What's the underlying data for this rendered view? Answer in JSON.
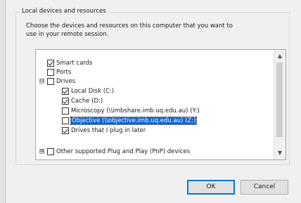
{
  "group": {
    "title": "Local devices and resources",
    "description_line1": "Choose the devices and resources on this computer that you want to",
    "description_line2": "use in your remote session."
  },
  "tree": {
    "items": [
      {
        "label": "Smart cards",
        "checked": true
      },
      {
        "label": "Ports",
        "checked": false
      },
      {
        "label": "Drives",
        "checked": false,
        "expander": "⊟"
      },
      {
        "label": "Local Disk (C:)",
        "checked": true
      },
      {
        "label": "Cache (D:)",
        "checked": true
      },
      {
        "label": "Microscopy (\\\\imbshare.imb.uq.edu.au) (Y:)",
        "checked": false
      },
      {
        "label": "Objective (\\\\objective.imb.uq.edu.au) (Z:)",
        "checked": false,
        "selected": true
      },
      {
        "label": "Drives that I plug in later",
        "checked": true
      },
      {
        "label": "Other supported Plug and Play (PnP) devices",
        "checked": false,
        "expander": "⊞"
      }
    ]
  },
  "scrollbar": {
    "up_icon": "▲",
    "down_icon": "▼"
  },
  "buttons": {
    "ok_label": "OK",
    "cancel_label": "Cancel"
  },
  "colors": {
    "selection": "#0a64d8",
    "default_button_border": "#0078d7"
  }
}
